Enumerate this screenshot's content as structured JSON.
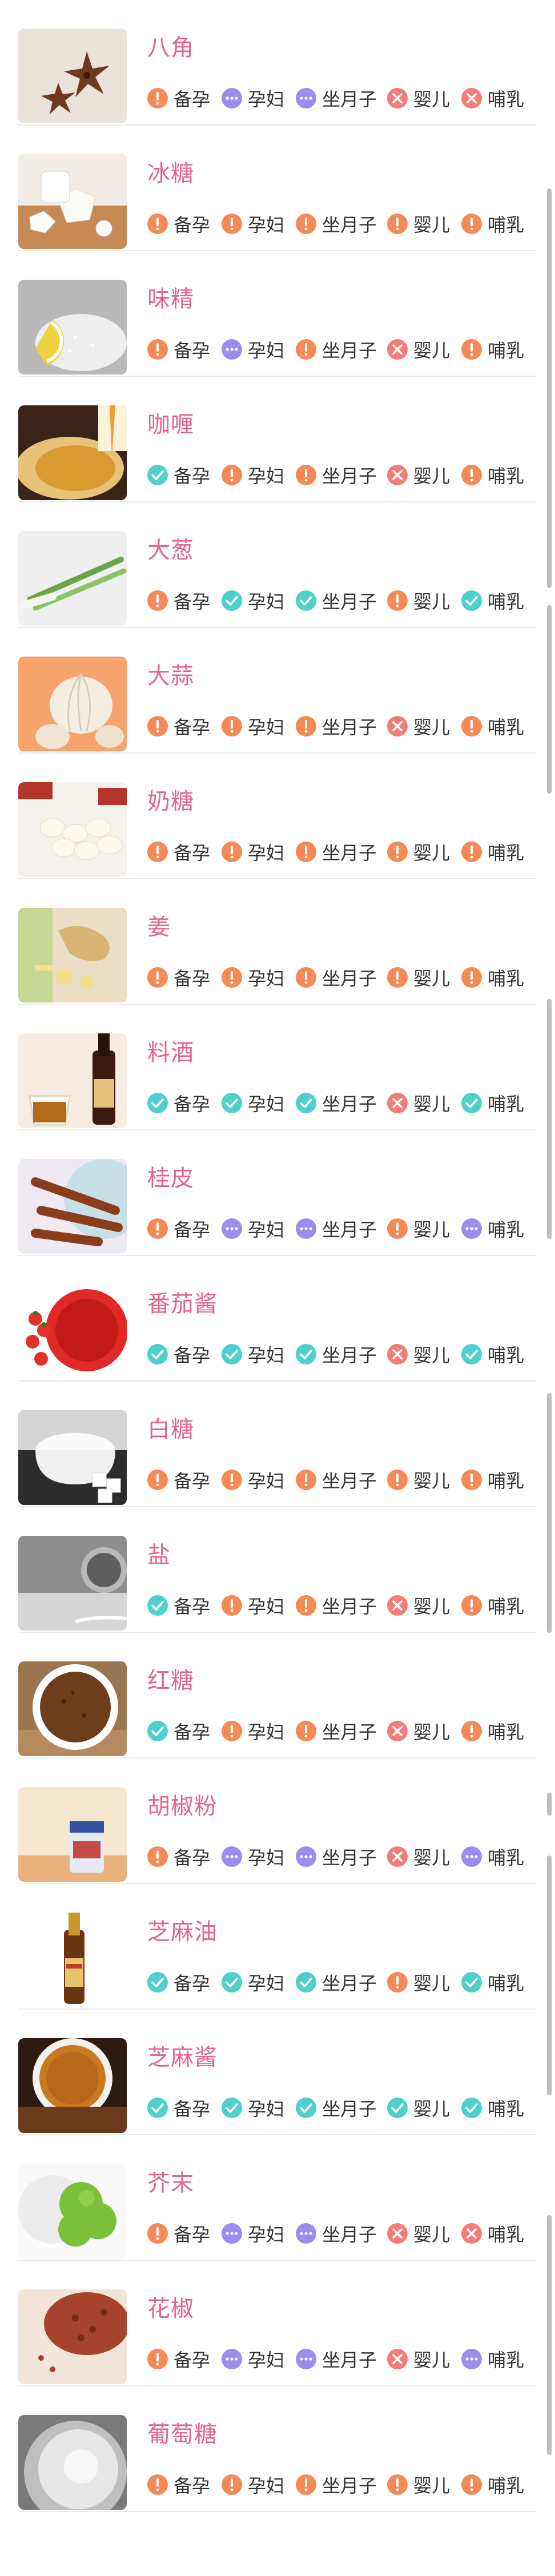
{
  "colors": {
    "caution": "#f58a56",
    "unknown": "#9d8cf0",
    "safe": "#4fd0cd",
    "forbidden": "#f47c78",
    "title": "#e4648f"
  },
  "status_labels": [
    "备孕",
    "孕妇",
    "坐月子",
    "婴儿",
    "哺乳"
  ],
  "items": [
    {
      "name": "八角",
      "statuses": [
        "caution",
        "unknown",
        "unknown",
        "forbidden",
        "forbidden"
      ],
      "thumb": "star-anise"
    },
    {
      "name": "冰糖",
      "statuses": [
        "caution",
        "caution",
        "caution",
        "caution",
        "caution"
      ],
      "thumb": "rock-sugar"
    },
    {
      "name": "味精",
      "statuses": [
        "caution",
        "unknown",
        "caution",
        "forbidden",
        "caution"
      ],
      "thumb": "msg"
    },
    {
      "name": "咖喱",
      "statuses": [
        "safe",
        "caution",
        "caution",
        "forbidden",
        "caution"
      ],
      "thumb": "curry"
    },
    {
      "name": "大葱",
      "statuses": [
        "caution",
        "safe",
        "safe",
        "caution",
        "safe"
      ],
      "thumb": "scallion"
    },
    {
      "name": "大蒜",
      "statuses": [
        "caution",
        "caution",
        "caution",
        "forbidden",
        "caution"
      ],
      "thumb": "garlic"
    },
    {
      "name": "奶糖",
      "statuses": [
        "caution",
        "caution",
        "caution",
        "caution",
        "caution"
      ],
      "thumb": "milk-candy"
    },
    {
      "name": "姜",
      "statuses": [
        "caution",
        "caution",
        "caution",
        "caution",
        "caution"
      ],
      "thumb": "ginger"
    },
    {
      "name": "料酒",
      "statuses": [
        "safe",
        "safe",
        "safe",
        "forbidden",
        "safe"
      ],
      "thumb": "cooking-wine"
    },
    {
      "name": "桂皮",
      "statuses": [
        "caution",
        "unknown",
        "unknown",
        "caution",
        "unknown"
      ],
      "thumb": "cinnamon"
    },
    {
      "name": "番茄酱",
      "statuses": [
        "safe",
        "safe",
        "safe",
        "forbidden",
        "safe"
      ],
      "thumb": "ketchup"
    },
    {
      "name": "白糖",
      "statuses": [
        "caution",
        "caution",
        "caution",
        "caution",
        "caution"
      ],
      "thumb": "white-sugar"
    },
    {
      "name": "盐",
      "statuses": [
        "safe",
        "caution",
        "caution",
        "forbidden",
        "caution"
      ],
      "thumb": "salt"
    },
    {
      "name": "红糖",
      "statuses": [
        "safe",
        "caution",
        "caution",
        "forbidden",
        "caution"
      ],
      "thumb": "brown-sugar"
    },
    {
      "name": "胡椒粉",
      "statuses": [
        "caution",
        "unknown",
        "unknown",
        "forbidden",
        "unknown"
      ],
      "thumb": "pepper-powder"
    },
    {
      "name": "芝麻油",
      "statuses": [
        "safe",
        "safe",
        "safe",
        "caution",
        "safe"
      ],
      "thumb": "sesame-oil"
    },
    {
      "name": "芝麻酱",
      "statuses": [
        "safe",
        "safe",
        "safe",
        "safe",
        "safe"
      ],
      "thumb": "sesame-paste"
    },
    {
      "name": "芥末",
      "statuses": [
        "caution",
        "unknown",
        "unknown",
        "forbidden",
        "forbidden"
      ],
      "thumb": "wasabi"
    },
    {
      "name": "花椒",
      "statuses": [
        "caution",
        "unknown",
        "unknown",
        "forbidden",
        "unknown"
      ],
      "thumb": "sichuan-pepper"
    },
    {
      "name": "葡萄糖",
      "statuses": [
        "caution",
        "caution",
        "caution",
        "caution",
        "caution"
      ],
      "thumb": "glucose"
    }
  ]
}
